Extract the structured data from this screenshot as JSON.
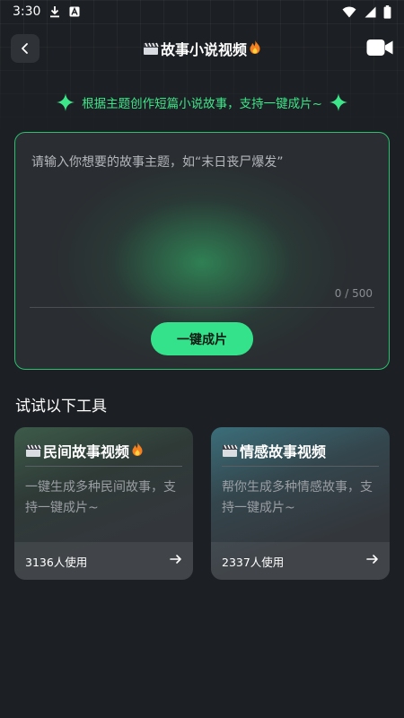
{
  "status_bar": {
    "time": "3:30",
    "icons": [
      "download-icon",
      "a-badge-icon",
      "wifi-icon",
      "signal-icon",
      "battery-icon"
    ]
  },
  "nav": {
    "title": "故事小说视频",
    "icons": [
      "back-icon",
      "clapperboard-icon",
      "fire-icon",
      "video-camera-icon"
    ]
  },
  "tagline": "根据主题创作短篇小说故事，支持一键成片~",
  "input": {
    "placeholder": "请输入你想要的故事主题，如“末日丧尸爆发”",
    "value": "",
    "char_count": "0 / 500"
  },
  "generate_button": "一键成片",
  "section_title": "试试以下工具",
  "tools": [
    {
      "title": "民间故事视频",
      "description": "一键生成多种民间故事，支持一键成片~",
      "usage": "3136人使用",
      "icons": [
        "clapperboard-icon",
        "fire-icon"
      ]
    },
    {
      "title": "情感故事视频",
      "description": "帮你生成多种情感故事，支持一键成片~",
      "usage": "2337人使用",
      "icons": [
        "clapperboard-icon"
      ]
    }
  ],
  "colors": {
    "accent": "#34e28c",
    "tagline": "#3ee68a",
    "background": "#1c1f23",
    "card": "#33373c"
  }
}
